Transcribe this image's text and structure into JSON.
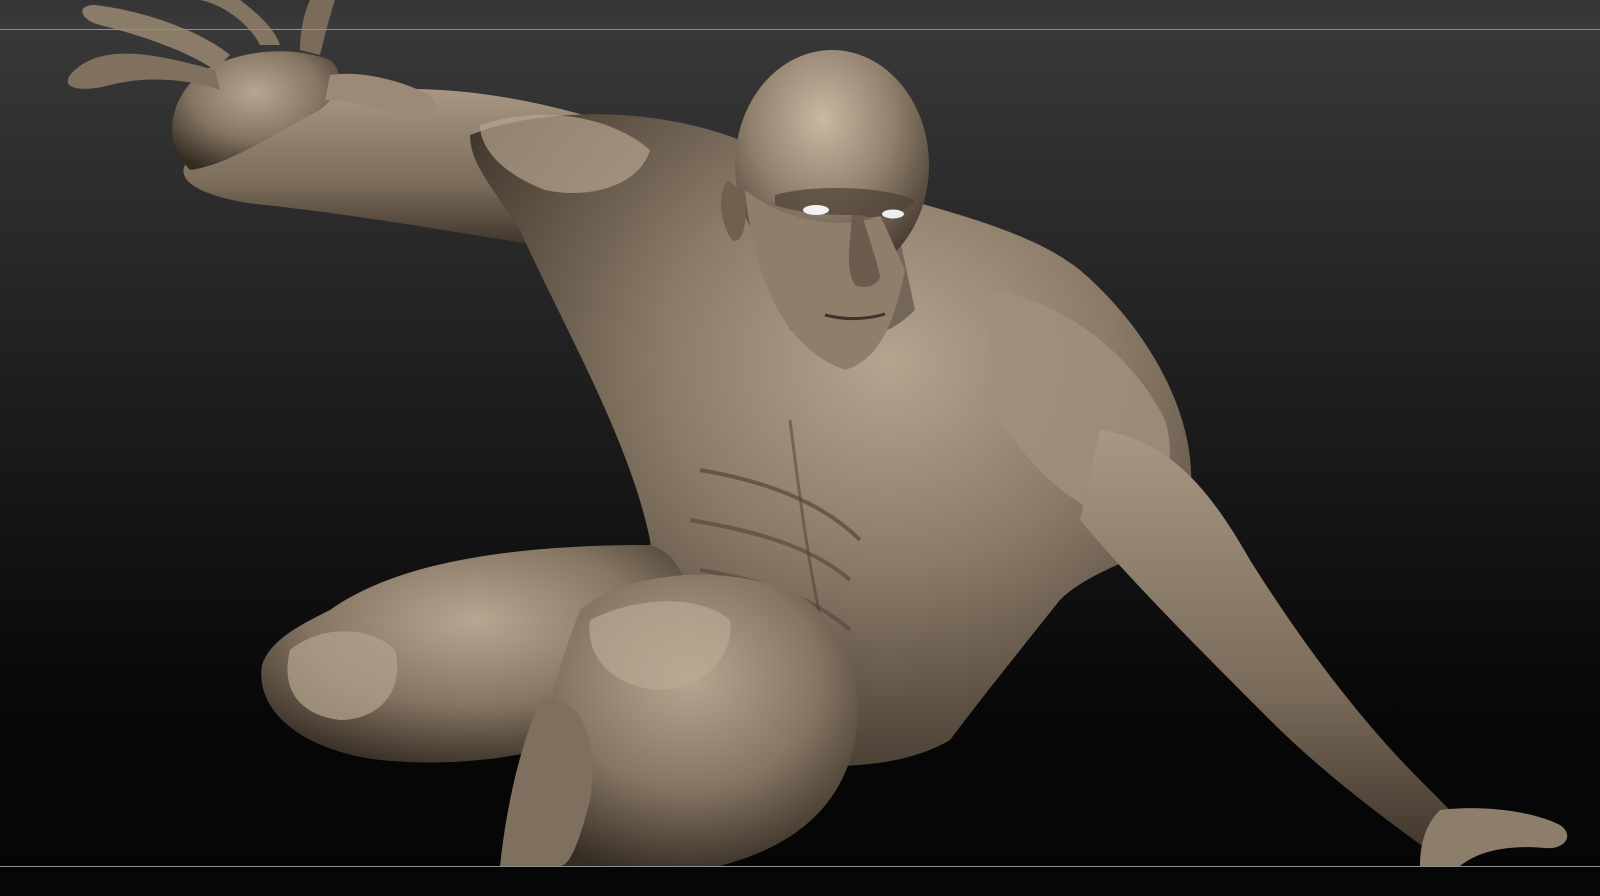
{
  "viewport": {
    "background_top": "#3a3a3a",
    "background_bottom": "#050505",
    "frame_line_color": "#8e8e8e"
  },
  "model": {
    "icon": "sculpt-figure-icon",
    "material_color": "#8a7a68",
    "material_highlight": "#c2b19c",
    "material_shadow": "#3a3026",
    "eye_color": "#f2f2f2"
  }
}
